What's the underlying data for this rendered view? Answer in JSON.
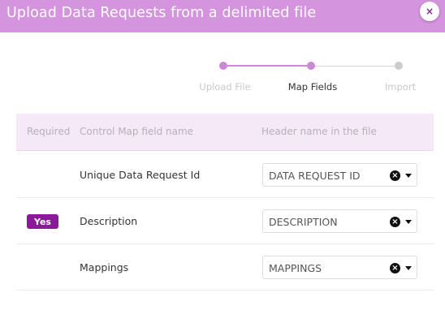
{
  "dialog": {
    "title": "Upload Data Requests from a delimited file",
    "close_icon": "×"
  },
  "stepper": {
    "steps": [
      {
        "label": "Upload File",
        "state": "done"
      },
      {
        "label": "Map Fields",
        "state": "active"
      },
      {
        "label": "Import",
        "state": "pending"
      }
    ]
  },
  "table": {
    "headers": {
      "required": "Required",
      "field_name": "Control Map field name",
      "header_name": "Header name in the file"
    },
    "rows": [
      {
        "required": "",
        "field_name": "Unique Data Request Id",
        "header_value": "DATA REQUEST ID"
      },
      {
        "required": "Yes",
        "field_name": "Description",
        "header_value": "DESCRIPTION"
      },
      {
        "required": "",
        "field_name": "Mappings",
        "header_value": "MAPPINGS"
      }
    ]
  },
  "icons": {
    "clear": "×"
  },
  "colors": {
    "title_bar": "#d494de",
    "accent": "#c989d3",
    "badge": "#8b1a9a",
    "header_bg": "#f5e8f7",
    "inactive": "#cccccc"
  }
}
